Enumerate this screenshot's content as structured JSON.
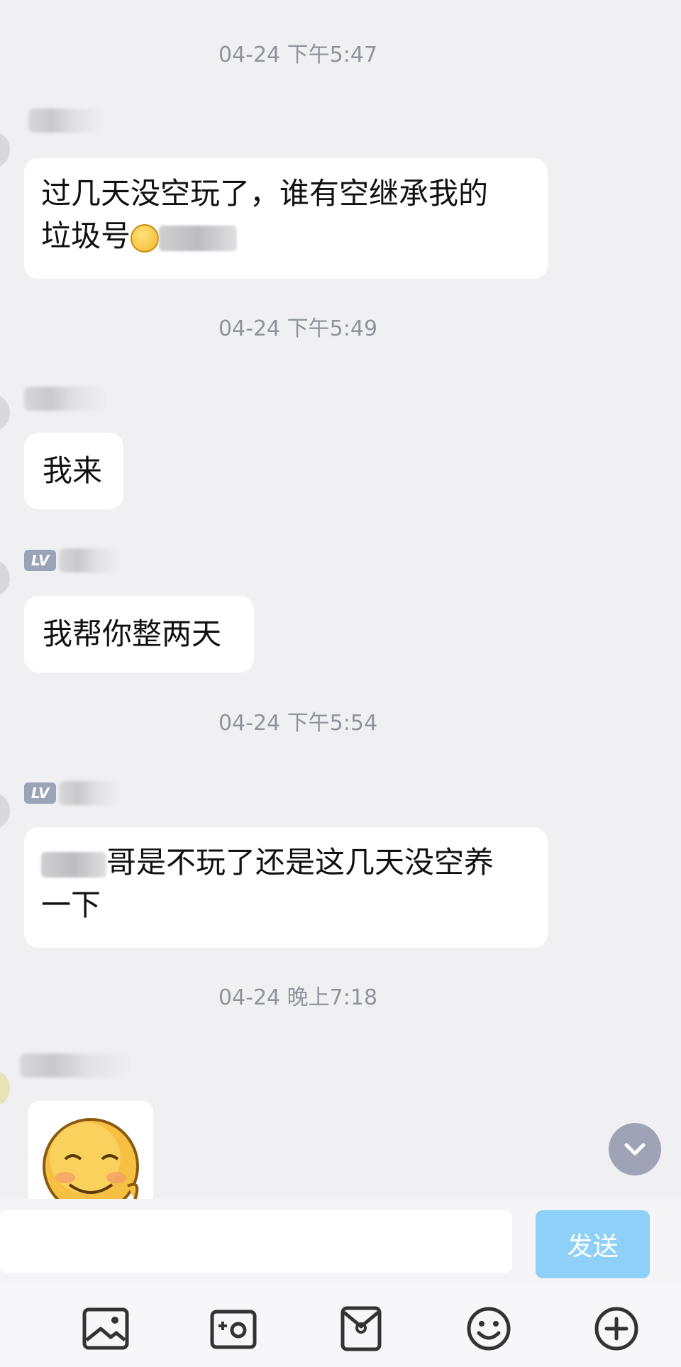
{
  "messages": {
    "m1": {
      "time": "04-24 下午5:47",
      "text_line1": "过几天没空玩了，谁有空继承我的",
      "text_line2": "垃圾号"
    },
    "m2": {
      "time": "04-24 下午5:49",
      "text": "我来"
    },
    "m3": {
      "text": "我帮你整两天"
    },
    "m4": {
      "time": "04-24 下午5:54",
      "badge": "LV",
      "text_line1": "哥是不玩了还是这几天没空养",
      "text_line2": "一下"
    },
    "m5": {
      "time": "04-24 晚上7:18"
    },
    "badge_m3": "LV"
  },
  "composer": {
    "input_value": "",
    "send_label": "发送"
  },
  "toolbar": {
    "icons": [
      "image-icon",
      "camera-icon",
      "red-packet-icon",
      "emoji-icon",
      "plus-icon"
    ]
  },
  "colors": {
    "background": "#f0f0f2",
    "send_button": "#8fd0f8",
    "timestamp": "#8f939b",
    "scroll_button": "#9ea4b6"
  }
}
